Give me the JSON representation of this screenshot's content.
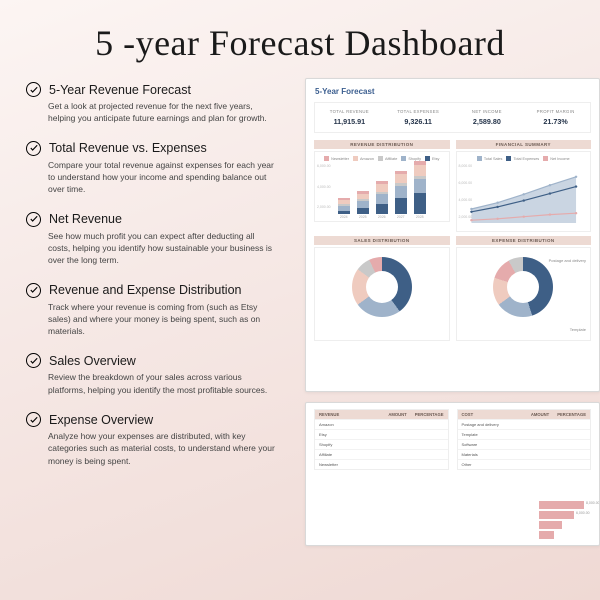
{
  "title": "5 -year Forecast Dashboard",
  "features": [
    {
      "title": "5-Year Revenue Forecast",
      "desc": "Get a look at projected revenue for the next five years, helping you anticipate future earnings and plan for growth."
    },
    {
      "title": "Total Revenue vs. Expenses",
      "desc": "Compare your total revenue against expenses for each year to understand how your income and spending balance out over time."
    },
    {
      "title": "Net Revenue",
      "desc": "See how much profit you can expect after deducting all costs, helping you identify how sustainable your business is over the long term."
    },
    {
      "title": "Revenue and Expense Distribution",
      "desc": "Track where your revenue is coming from (such as Etsy sales) and where your money is being spent, such as on materials."
    },
    {
      "title": "Sales Overview",
      "desc": "Review the breakdown of your sales across various platforms, helping you identify the most profitable sources."
    },
    {
      "title": "Expense Overview",
      "desc": "Analyze how your expenses are distributed, with key categories such as material costs, to understand where your money is being spent."
    }
  ],
  "dashboard": {
    "heading": "5-Year Forecast",
    "kpis": [
      {
        "label": "TOTAL REVENUE",
        "value": "11,915.91"
      },
      {
        "label": "TOTAL EXPENSES",
        "value": "9,326.11"
      },
      {
        "label": "NET INCOME",
        "value": "2,589.80"
      },
      {
        "label": "PROFIT MARGIN",
        "value": "21.73%"
      }
    ],
    "rev_header": "REVENUE DISTRIBUTION",
    "fin_header": "FINANCIAL SUMMARY",
    "sales_header": "SALES DISTRIBUTION",
    "exp_header": "EXPENSE DISTRIBUTION",
    "rev_legend": [
      "Newsletter",
      "Amazon",
      "Affiliate",
      "Shopify",
      "Etsy"
    ],
    "fin_legend": [
      "Total Sales",
      "Total Expenses",
      "Net Income"
    ],
    "donut_labels": {
      "sales": "",
      "exp1": "Postage and delivery",
      "exp2": "Template"
    },
    "tables": {
      "revenue_head": [
        "REVENUE",
        "AMOUNT",
        "PERCENTAGE"
      ],
      "cost_head": [
        "COST",
        "AMOUNT",
        "PERCENTAGE"
      ],
      "revenue_rows": [
        [
          "Amazon",
          "",
          ""
        ],
        [
          "Etsy",
          "",
          ""
        ],
        [
          "Shopify",
          "",
          ""
        ],
        [
          "Affiliate",
          "",
          ""
        ],
        [
          "Newsletter",
          "",
          ""
        ]
      ],
      "cost_rows": [
        [
          "Postage and delivery",
          "",
          ""
        ],
        [
          "Template",
          "",
          ""
        ],
        [
          "Software",
          "",
          ""
        ],
        [
          "Materials",
          "",
          ""
        ],
        [
          "Other",
          "",
          ""
        ]
      ]
    },
    "mini_bar_labels": [
      "8,000.00",
      "6,000.00"
    ]
  },
  "colors": {
    "blue": "#3e5f86",
    "lightblue": "#9fb3ca",
    "pink": "#e5abac",
    "peach": "#efcbbf",
    "grey": "#c9c9c9",
    "header": "#eddad3"
  },
  "chart_data": [
    {
      "type": "bar",
      "title": "REVENUE DISTRIBUTION",
      "categories": [
        "2024",
        "2025",
        "2026",
        "2027",
        "2028"
      ],
      "series": [
        {
          "name": "Newsletter",
          "values": [
            300,
            350,
            400,
            450,
            500
          ]
        },
        {
          "name": "Amazon",
          "values": [
            500,
            700,
            900,
            1100,
            1300
          ]
        },
        {
          "name": "Affiliate",
          "values": [
            200,
            250,
            300,
            350,
            400
          ]
        },
        {
          "name": "Shopify",
          "values": [
            600,
            900,
            1200,
            1500,
            1800
          ]
        },
        {
          "name": "Etsy",
          "values": [
            400,
            700,
            1300,
            2000,
            2600
          ]
        }
      ],
      "ylim": [
        0,
        7000
      ]
    },
    {
      "type": "area",
      "title": "FINANCIAL SUMMARY",
      "categories": [
        "2024",
        "2025",
        "2026",
        "2027",
        "2028"
      ],
      "series": [
        {
          "name": "Total Sales",
          "values": [
            2000,
            2900,
            4100,
            5400,
            6600
          ]
        },
        {
          "name": "Total Expenses",
          "values": [
            1600,
            2300,
            3200,
            4200,
            5200
          ]
        },
        {
          "name": "Net Income",
          "values": [
            400,
            600,
            900,
            1200,
            1400
          ]
        }
      ],
      "ylim": [
        0,
        8000
      ]
    },
    {
      "type": "pie",
      "title": "SALES DISTRIBUTION",
      "series": [
        {
          "name": "Etsy",
          "value": 40
        },
        {
          "name": "Shopify",
          "value": 25
        },
        {
          "name": "Amazon",
          "value": 20
        },
        {
          "name": "Affiliate",
          "value": 8
        },
        {
          "name": "Newsletter",
          "value": 7
        }
      ]
    },
    {
      "type": "pie",
      "title": "EXPENSE DISTRIBUTION",
      "series": [
        {
          "name": "Postage and delivery",
          "value": 45
        },
        {
          "name": "Template",
          "value": 20
        },
        {
          "name": "Software",
          "value": 15
        },
        {
          "name": "Materials",
          "value": 12
        },
        {
          "name": "Other",
          "value": 8
        }
      ]
    }
  ]
}
